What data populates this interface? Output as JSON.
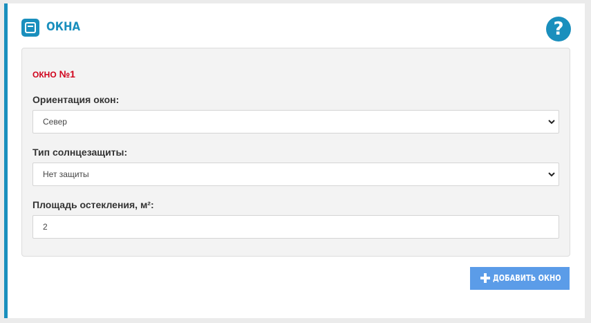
{
  "section": {
    "title": "ОКНА",
    "icon": "window-icon",
    "help_icon": "question-circle-icon",
    "help_symbol": "?"
  },
  "window_panel": {
    "title_prefix": "ОКНО",
    "title_number": "№1",
    "orientation": {
      "label": "Ориентация окон:",
      "value": "Север"
    },
    "sun_protection": {
      "label": "Тип солнцезащиты:",
      "value": "Нет защиты"
    },
    "glazing_area": {
      "label": "Площадь остекления, м²:",
      "value": "2"
    }
  },
  "add_button": {
    "label": "ДОБАВИТЬ ОКНО",
    "icon": "plus-icon"
  },
  "colors": {
    "accent": "#1a8fbd",
    "panel_title": "#d0021b",
    "button": "#5b9ce8"
  }
}
